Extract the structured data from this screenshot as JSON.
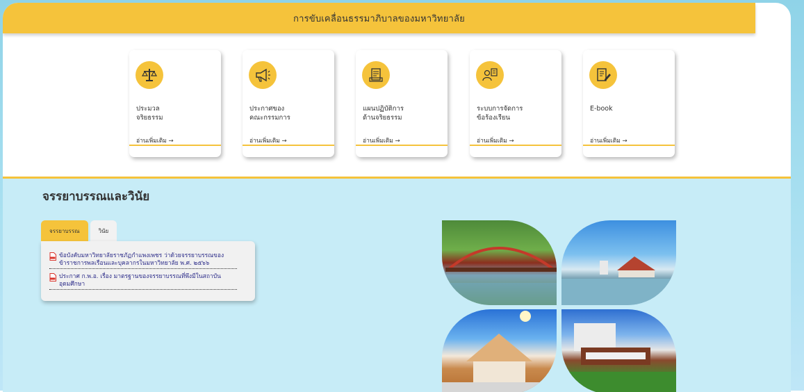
{
  "header": {
    "title": "การขับเคลื่อนธรรมาภิบาลของมหาวิทยาลัย"
  },
  "cards": [
    {
      "title_line1": "ประมวล",
      "title_line2": "จริยธรรม",
      "link": "อ่านเพิ่มเติม →",
      "icon": "ethics-scale-icon"
    },
    {
      "title_line1": "ประกาศของ",
      "title_line2": "คณะกรรมการ",
      "link": "อ่านเพิ่มเติม →",
      "icon": "megaphone-icon"
    },
    {
      "title_line1": "แผนปฏิบัติการ",
      "title_line2": "ด้านจริยธรรม",
      "link": "อ่านเพิ่มเติม →",
      "icon": "plan-document-icon"
    },
    {
      "title_line1": "ระบบการจัดการ",
      "title_line2": "ข้อร้องเรียน",
      "link": "อ่านเพิ่มเติม →",
      "icon": "complaint-person-icon"
    },
    {
      "title_line1": "E-book",
      "title_line2": "",
      "link": "อ่านเพิ่มเติม →",
      "icon": "ebook-edit-icon"
    }
  ],
  "section": {
    "title": "จรรยาบรรณและวินัย",
    "tabs": [
      {
        "label": "จรรยาบรรณ",
        "active": true
      },
      {
        "label": "วินัย",
        "active": false
      }
    ],
    "documents": [
      {
        "line1": "ข้อบังคับมหาวิทยาลัยราชภัฏกำแพงเพชร ว่าด้วยจรรยาบรรณของ",
        "line2": "ข้าราชการพลเรือนและบุคลากรในมหาวิทยาลัย พ.ศ. ๒๕๖๖"
      },
      {
        "line1": "ประกาศ ก.พ.อ. เรื่อง มาตรฐานของจรรยาบรรณที่พึงมีในสถาบัน",
        "line2": "อุดมศึกษา"
      }
    ]
  },
  "colors": {
    "accent": "#f5c33b",
    "section_bg": "#c7ecf7",
    "link_text": "#2e2e8a",
    "pdf_red": "#d9342b"
  }
}
